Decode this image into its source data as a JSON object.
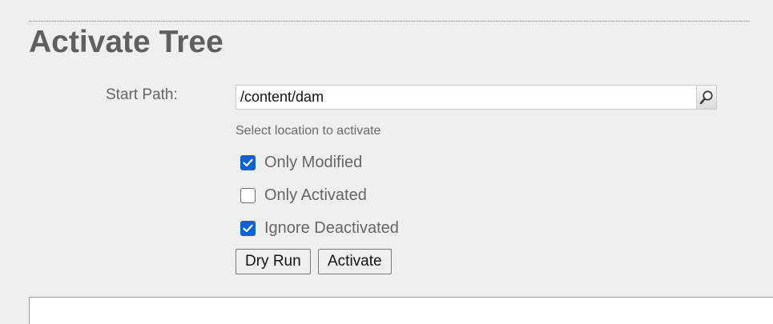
{
  "header": {
    "title": "Activate Tree"
  },
  "form": {
    "start_path_label": "Start Path:",
    "start_path_value": "/content/dam",
    "start_path_hint": "Select location to activate",
    "search_icon": "magnifier-icon",
    "options": [
      {
        "label": "Only Modified",
        "checked": true
      },
      {
        "label": "Only Activated",
        "checked": false
      },
      {
        "label": "Ignore Deactivated",
        "checked": true
      }
    ],
    "buttons": {
      "dry_run": "Dry Run",
      "activate": "Activate"
    }
  },
  "colors": {
    "accent": "#0a63d6",
    "title": "#5f5f5f",
    "background": "#efefef"
  }
}
